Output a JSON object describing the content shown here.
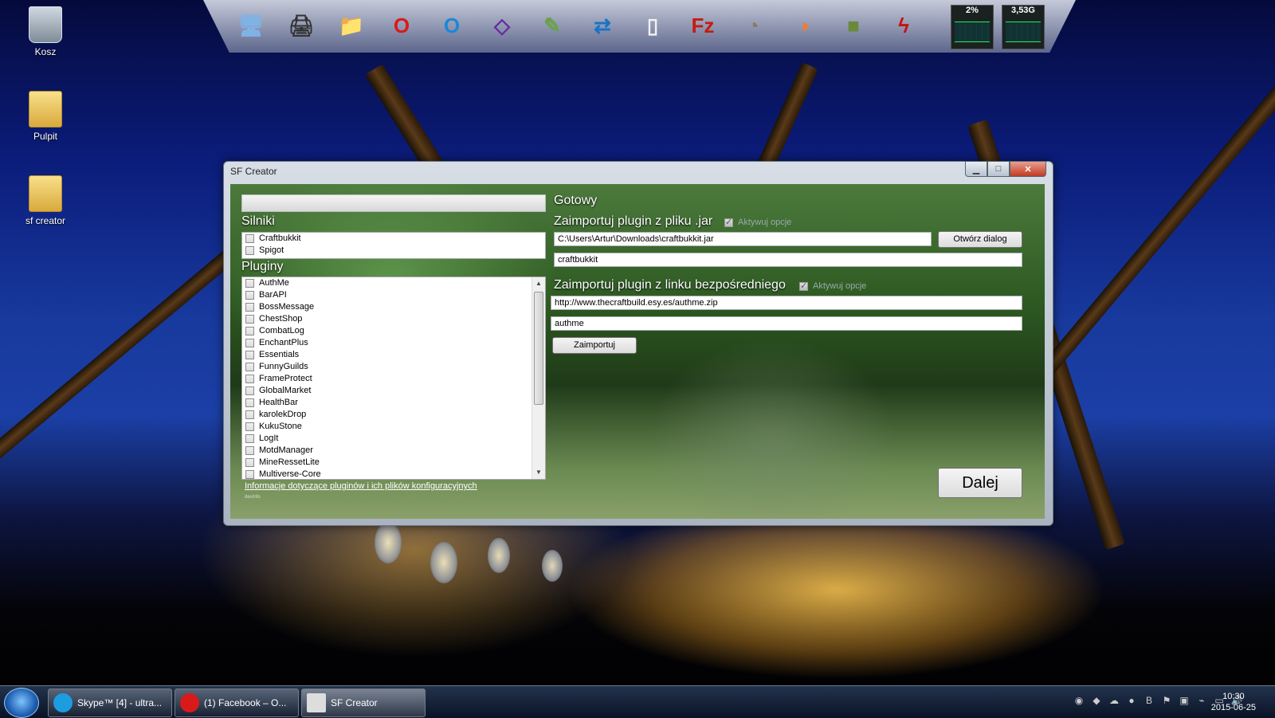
{
  "desktop": {
    "icons": [
      {
        "label": "Kosz",
        "icon": "recycle-bin-icon"
      },
      {
        "label": "Pulpit",
        "icon": "folder-icon"
      },
      {
        "label": "sf creator",
        "icon": "folder-icon"
      }
    ]
  },
  "dock": {
    "items": [
      {
        "name": "computer-icon",
        "glyph": "🖥",
        "color": "#7fb3e6"
      },
      {
        "name": "printer-icon",
        "glyph": "🖨",
        "color": "#333333"
      },
      {
        "name": "folder-icon",
        "glyph": "📁",
        "color": "#e8c35a"
      },
      {
        "name": "opera-icon",
        "glyph": "O",
        "color": "#d91a1a"
      },
      {
        "name": "opera-blue-icon",
        "glyph": "O",
        "color": "#1e86d8"
      },
      {
        "name": "visual-studio-icon",
        "glyph": "◇",
        "color": "#6a2ca0"
      },
      {
        "name": "editor-icon",
        "glyph": "✎",
        "color": "#6aa04a"
      },
      {
        "name": "teamviewer-icon",
        "glyph": "⇄",
        "color": "#1a74c8"
      },
      {
        "name": "document-icon",
        "glyph": "▯",
        "color": "#f2f2f2"
      },
      {
        "name": "filezilla-icon",
        "glyph": "Fz",
        "color": "#c81a10"
      },
      {
        "name": "gimp-icon",
        "glyph": "◔",
        "color": "#8a7a60"
      },
      {
        "name": "office-icon",
        "glyph": "◑",
        "color": "#ef7a3a"
      },
      {
        "name": "minecraft-icon",
        "glyph": "■",
        "color": "#6a8a3a"
      },
      {
        "name": "flash-icon",
        "glyph": "ϟ",
        "color": "#c81010"
      }
    ],
    "cpu_meter": "2%",
    "mem_meter": "3,53G"
  },
  "window": {
    "title": "SF Creator",
    "min_label": "▁",
    "max_label": "□",
    "close_label": "✕",
    "silniki_header": "Silniki",
    "silniki": [
      "Craftbukkit",
      "Spigot"
    ],
    "pluginy_header": "Pluginy",
    "pluginy": [
      "AuthMe",
      "BarAPI",
      "BossMessage",
      "ChestShop",
      "CombatLog",
      "EnchantPlus",
      "Essentials",
      "FunnyGuilds",
      "FrameProtect",
      "GlobalMarket",
      "HealthBar",
      "karolekDrop",
      "KukuStone",
      "LogIt",
      "MotdManager",
      "MineRessetLite",
      "Multiverse-Core"
    ],
    "info_link": "Informacje dotyczące pluginów i ich plików konfiguracyjnych",
    "dev_info": "devInfo",
    "status": "Gotowy",
    "import_file_title": "Zaimportuj plugin z pliku .jar",
    "active_options_1": "Aktywuj opcje",
    "file_path": "C:\\Users\\Artur\\Downloads\\craftbukkit.jar",
    "open_dialog_btn": "Otwórz dialog",
    "file_name": "craftbukkit",
    "import_link_title": "Zaimportuj plugin z linku bezpośredniego",
    "active_options_2": "Aktywuj opcje",
    "link_url": "http://www.thecraftbuild.esy.es/authme.zip",
    "link_name": "authme",
    "import_btn": "Zaimportuj",
    "next_btn": "Dalej"
  },
  "taskbar": {
    "tasks": [
      {
        "label": "Skype™ [4] - ultra...",
        "icon": "skype-icon",
        "color": "#1e9ce0"
      },
      {
        "label": "(1) Facebook – O...",
        "icon": "opera-icon",
        "color": "#d91a1a"
      },
      {
        "label": "SF Creator",
        "icon": "window-icon",
        "color": "#dddddd"
      }
    ],
    "tray": [
      "steam-icon",
      "diamond-icon",
      "network-icon",
      "badge-icon",
      "b-icon",
      "flag-icon",
      "nvidia-icon",
      "usb-icon",
      "monitor-icon",
      "volume-icon"
    ],
    "time": "10:30",
    "date": "2015-06-25"
  }
}
